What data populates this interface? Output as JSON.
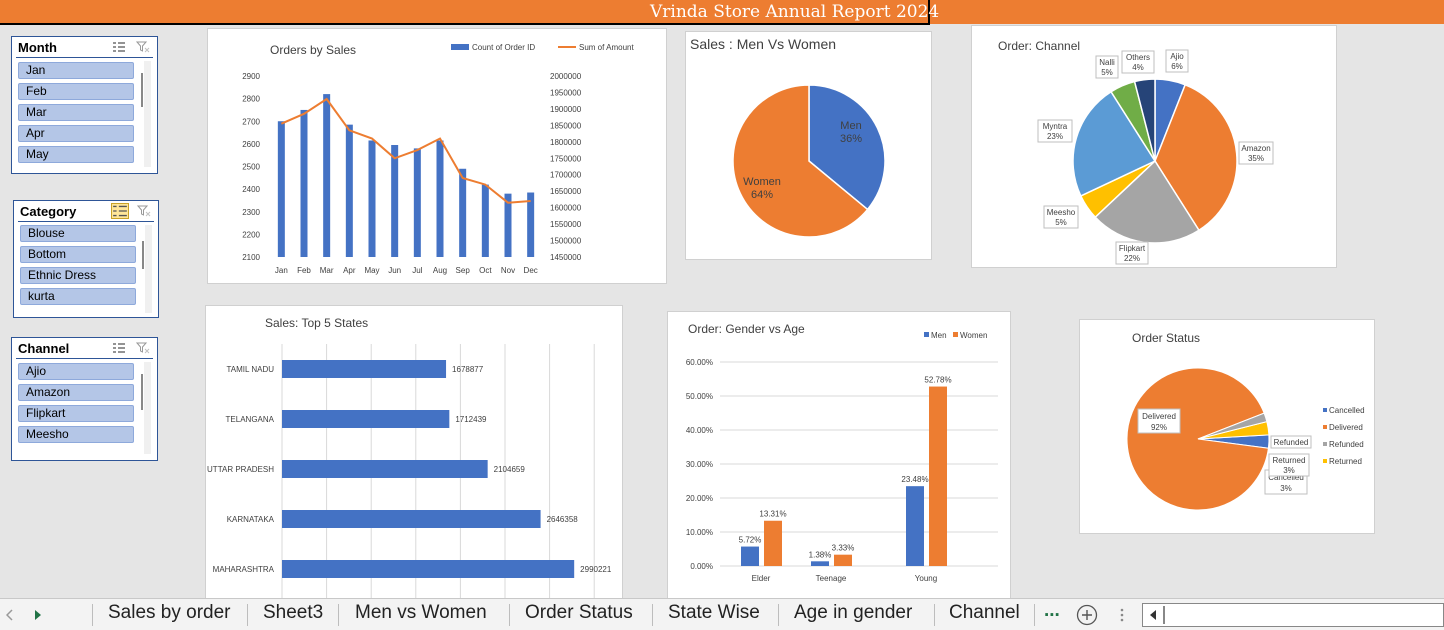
{
  "header": {
    "title": "Vrinda Store Annual Report 2024"
  },
  "slicers": {
    "month": {
      "title": "Month",
      "items": [
        "Jan",
        "Feb",
        "Mar",
        "Apr",
        "May"
      ]
    },
    "category": {
      "title": "Category",
      "items": [
        "Blouse",
        "Bottom",
        "Ethnic Dress",
        "kurta"
      ]
    },
    "channel": {
      "title": "Channel",
      "items": [
        "Ajio",
        "Amazon",
        "Flipkart",
        "Meesho"
      ]
    }
  },
  "tabs": [
    "Sales by order",
    "Sheet3",
    "Men vs Women",
    "Order Status",
    "State Wise",
    "Age in gender",
    "Channel",
    "..."
  ],
  "colors": {
    "blue": "#4472c4",
    "orange": "#ed7d31",
    "gray": "#a5a5a5",
    "yellow": "#ffc000",
    "lightblue": "#5b9bd5",
    "green": "#70ad47",
    "navy": "#264478",
    "title": "#ed7d31"
  },
  "chart_data": [
    {
      "type": "bar",
      "title": "Orders by Sales",
      "categories": [
        "Jan",
        "Feb",
        "Mar",
        "Apr",
        "May",
        "Jun",
        "Jul",
        "Aug",
        "Sep",
        "Oct",
        "Nov",
        "Dec"
      ],
      "series": [
        {
          "name": "Count of Order ID",
          "type": "bar",
          "axis": "left",
          "values": [
            2700,
            2750,
            2820,
            2685,
            2615,
            2595,
            2580,
            2615,
            2490,
            2420,
            2380,
            2385
          ]
        },
        {
          "name": "Sum of Amount",
          "type": "line",
          "axis": "right",
          "values": [
            1855000,
            1885000,
            1930000,
            1835000,
            1810000,
            1750000,
            1775000,
            1810000,
            1690000,
            1670000,
            1615000,
            1620000
          ]
        }
      ],
      "ylim_left": [
        2100,
        2900
      ],
      "yticks_left": [
        "2900",
        "2800",
        "2700",
        "2600",
        "2500",
        "2400",
        "2300",
        "2200",
        "2100"
      ],
      "ylim_right": [
        1450000,
        2000000
      ],
      "yticks_right": [
        "2000000",
        "1950000",
        "1900000",
        "1850000",
        "1800000",
        "1750000",
        "1700000",
        "1650000",
        "1600000",
        "1550000",
        "1500000",
        "1450000"
      ],
      "legend": "top-right"
    },
    {
      "type": "pie",
      "title": "Sales : Men Vs Women",
      "categories": [
        "Men",
        "Women"
      ],
      "values": [
        36,
        64
      ],
      "labels": [
        "Men\n36%",
        "Women\n64%"
      ]
    },
    {
      "type": "pie",
      "title": "Order: Channel",
      "categories": [
        "Ajio",
        "Amazon",
        "Flipkart",
        "Meesho",
        "Myntra",
        "Nalli",
        "Others"
      ],
      "values": [
        6,
        35,
        22,
        5,
        23,
        5,
        4
      ],
      "pct_labels": [
        "6%",
        "35%",
        "22%",
        "5%",
        "23%",
        "5%",
        "4%"
      ]
    },
    {
      "type": "bar",
      "orientation": "horizontal",
      "title": "Sales: Top 5 States",
      "categories": [
        "TAMIL NADU",
        "TELANGANA",
        "UTTAR PRADESH",
        "KARNATAKA",
        "MAHARASHTRA"
      ],
      "values": [
        1678877,
        1712439,
        2104659,
        2646358,
        2990221
      ],
      "value_labels": [
        "1678877",
        "1712439",
        "2104659",
        "2646358",
        "2990221"
      ],
      "xlim": [
        0,
        3500000
      ]
    },
    {
      "type": "bar",
      "title": "Order: Gender vs Age",
      "categories": [
        "Elder",
        "Teenage",
        "Young"
      ],
      "series": [
        {
          "name": "Men",
          "values": [
            5.72,
            1.38,
            23.48
          ],
          "labels": [
            "5.72%",
            "1.38%",
            "23.48%"
          ]
        },
        {
          "name": "Women",
          "values": [
            13.31,
            3.33,
            52.78
          ],
          "labels": [
            "13.31%",
            "3.33%",
            "52.78%"
          ]
        }
      ],
      "ylim": [
        0,
        60
      ],
      "yticks": [
        "60.00%",
        "50.00%",
        "40.00%",
        "30.00%",
        "20.00%",
        "10.00%",
        "0.00%"
      ],
      "legend": "top-right"
    },
    {
      "type": "pie",
      "title": "Order Status",
      "categories": [
        "Cancelled",
        "Delivered",
        "Refunded",
        "Returned"
      ],
      "values": [
        3,
        92,
        2,
        3
      ],
      "pct_labels": [
        "3%",
        "92%",
        "",
        "3%"
      ],
      "legend": "right"
    }
  ]
}
